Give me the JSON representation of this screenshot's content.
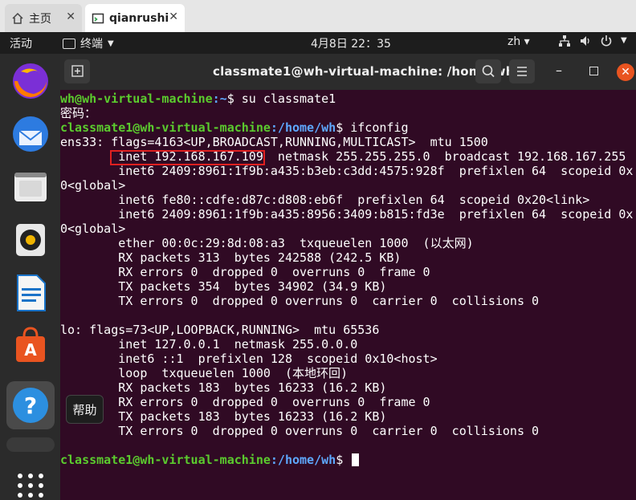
{
  "browser": {
    "tabs": [
      {
        "label": "主页",
        "icon": "home-icon"
      },
      {
        "label": "qianrushi",
        "icon": "terminal-tab-icon"
      }
    ]
  },
  "topbar": {
    "activities": "活动",
    "app_label": "终端",
    "clock": "4月8日  22：35",
    "ime": "zh"
  },
  "window": {
    "title": "classmate1@wh-virtual-machine: /home/wh"
  },
  "dock": {
    "tooltip": "帮助",
    "items": [
      "firefox-icon",
      "thunderbird-icon",
      "files-icon",
      "rhythmbox-icon",
      "writer-icon",
      "software-icon",
      "help-icon"
    ]
  },
  "terminal": {
    "line01": {
      "user": "wh@wh-virtual-machine",
      "path": ":~",
      "cmd": "$ su classmate1"
    },
    "line02": "密码：",
    "line03": {
      "user": "classmate1@wh-virtual-machine",
      "path": ":/home/wh",
      "cmd": "$ ifconfig"
    },
    "line04": "ens33: flags=4163<UP,BROADCAST,RUNNING,MULTICAST>  mtu 1500",
    "line05": "        inet 192.168.167.109  netmask 255.255.255.0  broadcast 192.168.167.255",
    "line06": "        inet6 2409:8961:1f9b:a435:b3eb:c3dd:4575:928f  prefixlen 64  scopeid 0x",
    "line07": "0<global>",
    "line08": "        inet6 fe80::cdfe:d87c:d808:eb6f  prefixlen 64  scopeid 0x20<link>",
    "line09": "        inet6 2409:8961:1f9b:a435:8956:3409:b815:fd3e  prefixlen 64  scopeid 0x",
    "line10": "0<global>",
    "line11": "        ether 00:0c:29:8d:08:a3  txqueuelen 1000  (以太网)",
    "line12": "        RX packets 313  bytes 242588 (242.5 KB)",
    "line13": "        RX errors 0  dropped 0  overruns 0  frame 0",
    "line14": "        TX packets 354  bytes 34902 (34.9 KB)",
    "line15": "        TX errors 0  dropped 0 overruns 0  carrier 0  collisions 0",
    "line16": "",
    "line17": "lo: flags=73<UP,LOOPBACK,RUNNING>  mtu 65536",
    "line18": "        inet 127.0.0.1  netmask 255.0.0.0",
    "line19": "        inet6 ::1  prefixlen 128  scopeid 0x10<host>",
    "line20": "        loop  txqueuelen 1000  (本地环回)",
    "line21": "        RX packets 183  bytes 16233 (16.2 KB)",
    "line22": "        RX errors 0  dropped 0  overruns 0  frame 0",
    "line23": "        TX packets 183  bytes 16233 (16.2 KB)",
    "line24": "        TX errors 0  dropped 0 overruns 0  carrier 0  collisions 0",
    "line25": "",
    "line26": {
      "user": "classmate1@wh-virtual-machine",
      "path": ":/home/wh",
      "cmd": "$ "
    }
  },
  "colors": {
    "accent": "#e95420",
    "prompt_user": "#5bcb2e",
    "prompt_path": "#5ea8ff",
    "highlight_box": "#e02020"
  }
}
